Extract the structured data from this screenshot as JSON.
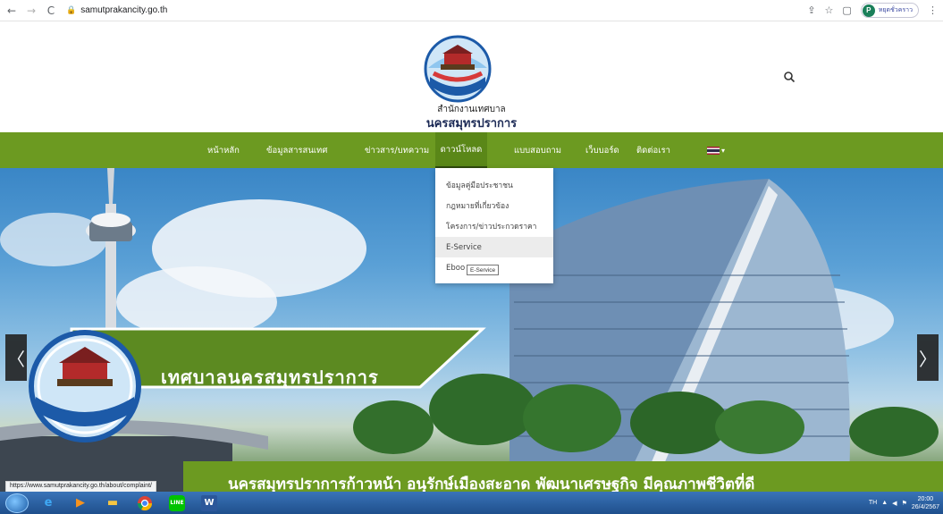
{
  "browser": {
    "url": "samutprakancity.go.th",
    "profile_initial": "P",
    "profile_label": "หยุดชั่วคราว"
  },
  "site": {
    "org_name_small": "สำนักงานเทศบาล",
    "org_name_big": "นครสมุทรปราการ"
  },
  "nav": {
    "items": [
      {
        "label": "หน้าหลัก"
      },
      {
        "label": "ข้อมูลสารสนเทศ"
      },
      {
        "label": "ข่าวสาร/บทความ"
      },
      {
        "label": "ดาวน์โหลด"
      },
      {
        "label": "แบบสอบถาม"
      },
      {
        "label": "เว็บบอร์ด"
      },
      {
        "label": "ติดต่อเรา"
      }
    ],
    "active_index": 3,
    "accent_color": "#6c9a21"
  },
  "dropdown": {
    "items": [
      {
        "label": "ข้อมูลคู่มือประชาชน"
      },
      {
        "label": "กฎหมายที่เกี่ยวข้อง"
      },
      {
        "label": "โครงการ/ข่าวประกวดราคา"
      },
      {
        "label": "E-Service"
      },
      {
        "label": "Eboo"
      }
    ],
    "hover_index": 3,
    "tooltip": "E-Service"
  },
  "hero": {
    "banner_text": "เทศบาลนครสมุทรปราการ",
    "bottom_banner": "นครสมุทรปราการก้าวหน้า   อนุรักษ์เมืองสะอาด   พัฒนาเศรษฐกิจ   มีคุณภาพชีวิตที่ดี",
    "prev_arrow": "〈",
    "next_arrow": "〉"
  },
  "status_bar_url": "https://www.samutprakancity.go.th/about/complaint/",
  "taskbar": {
    "lang": "TH",
    "time": "20:00",
    "date": "26/4/2567"
  }
}
